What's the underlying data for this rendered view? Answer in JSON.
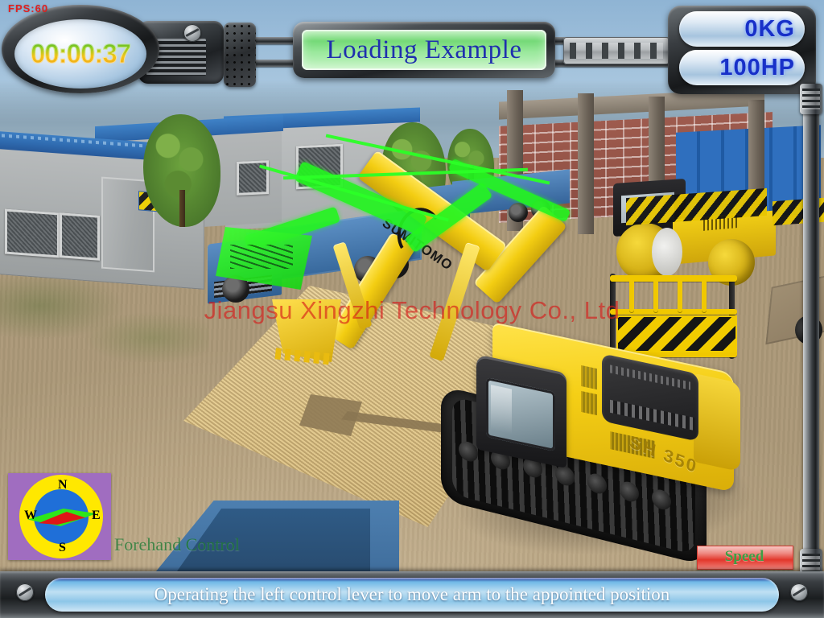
{
  "app": {
    "title": "Loading Example",
    "watermark": "Jiangsu Xingzhi Technology Co., Ltd"
  },
  "hud": {
    "fps_label": "FPS:60",
    "timer": "00:00:37",
    "gauges": [
      {
        "name": "load-weight",
        "value": "0KG"
      },
      {
        "name": "engine-power",
        "value": "100HP"
      }
    ]
  },
  "compass": {
    "north": "N",
    "east": "E",
    "south": "S",
    "west": "W"
  },
  "overlay": {
    "mode_label": "Forehand Control",
    "speed_button": "Speed"
  },
  "status": {
    "message": "Operating the left control lever to move arm to the appointed position"
  },
  "scene": {
    "machine_brand": "SUMITOMO",
    "machine_model": "SH 350"
  },
  "colors": {
    "title_text": "#1f2fae",
    "title_panel": "#74d977",
    "gauge_text": "#1830c8",
    "watermark": "#d61616",
    "status_text": "#ffffff",
    "forehand": "#1e7a33",
    "speed_text": "#3f9e44",
    "timer_gradient_start": "#2fa22a",
    "timer_gradient_end": "#f09a12",
    "machine_yellow": "#f3cd12",
    "ghost_green": "#24f520"
  }
}
